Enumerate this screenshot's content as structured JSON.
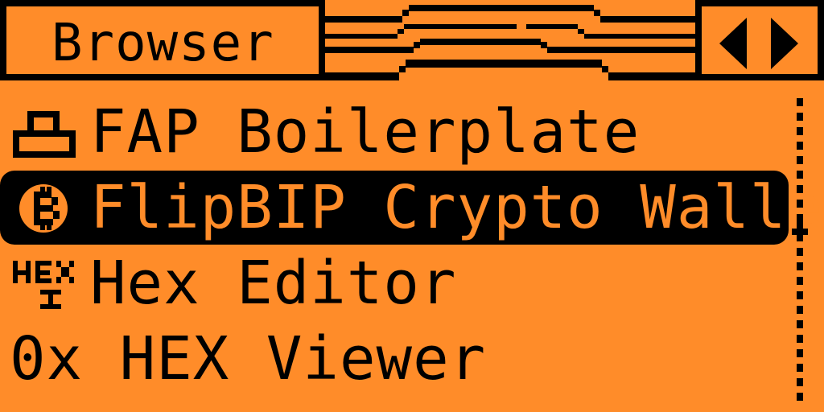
{
  "window": {
    "title": "Browser"
  },
  "list": {
    "items": [
      {
        "label": "FAP Boilerplate",
        "icon": "app-icon"
      },
      {
        "label": "FlipBIP Crypto Wallet",
        "icon": "bitcoin-icon"
      },
      {
        "label": "Hex Editor",
        "icon": "hex-editor-icon"
      },
      {
        "label": "0x HEX Viewer",
        "icon": "hex-viewer-icon"
      }
    ],
    "selected_index": 1
  },
  "colors": {
    "background": "#ff8c29",
    "foreground": "#000000"
  }
}
